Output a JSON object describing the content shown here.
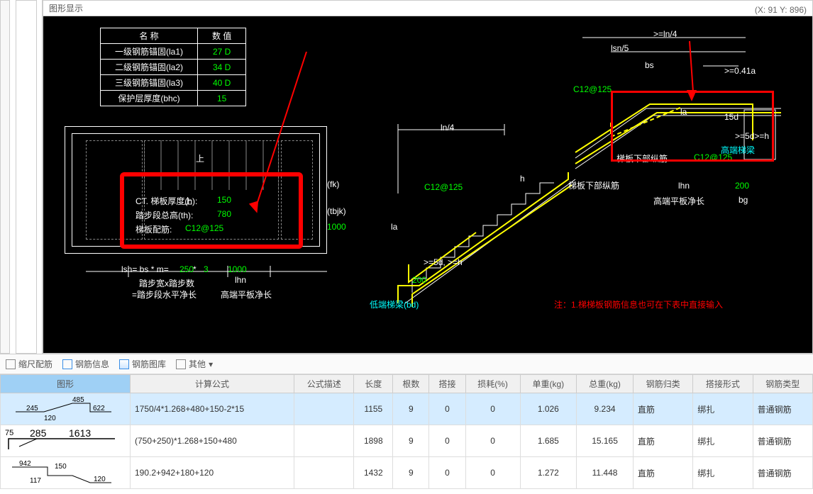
{
  "panel_title": "图形显示",
  "coord_text": "(X: 91 Y: 896)",
  "param_table": {
    "header_name": "名  称",
    "header_value": "数  值",
    "rows": [
      {
        "name": "一级钢筋锚固(la1)",
        "value": "27 D"
      },
      {
        "name": "二级钢筋锚固(la2)",
        "value": "34 D"
      },
      {
        "name": "三级钢筋锚固(la3)",
        "value": "40 D"
      },
      {
        "name": "保护层厚度(bhc)",
        "value": "15"
      }
    ]
  },
  "left_box": {
    "l1": "CT. 梯板厚度(h):",
    "v1": "150",
    "l2": "踏步段总高(th):",
    "v2": "780",
    "l3": "梯板配筋:",
    "v3": "C12@125",
    "lsn_label": "lsn= bs * m=",
    "lsn_v1": "250",
    "lsn_star": " * ",
    "lsn_v2": "3",
    "lsn_rhs": "1000",
    "lhn_lbl": "lhn",
    "foot1": "踏步宽x踏步数",
    "foot2": "=踏步段水平净长",
    "foot3": "高端平板净长",
    "fk": "(fk)",
    "tbjk": "(tbjk)",
    "v1000": "1000",
    "up": "上"
  },
  "middle": {
    "ln4": "ln/4",
    "c12": "C12@125",
    "la": "la",
    "gte": ">=5d, >=h",
    "v200": "200",
    "bottom_label": "低端梯梁(bd)",
    "h": "h",
    "bottom_long": "梯板下部纵筋"
  },
  "right": {
    "top1": ">=ln/4",
    "top2": "lsn/5",
    "bs": "bs",
    "c12": "C12@125",
    "la": "la",
    "ge041": ">=0.41a",
    "fifteen_d": "15d",
    "ge5d": ">=5d>=h",
    "label_high": "高端梯梁",
    "bottom_long": "梯板下部纵筋",
    "c12b": "C12@125",
    "lhn": "lhn",
    "foot": "高端平板净长",
    "v200": "200",
    "bg": "bg",
    "note": "注：1.梯梯板钢筋信息也可在下表中直接输入"
  },
  "toolbar": {
    "ruler": "缩尺配筋",
    "info": "钢筋信息",
    "lib": "钢筋图库",
    "other": "其他"
  },
  "grid": {
    "headers": [
      "图形",
      "计算公式",
      "公式描述",
      "长度",
      "根数",
      "搭接",
      "损耗(%)",
      "单重(kg)",
      "总重(kg)",
      "钢筋归类",
      "搭接形式",
      "钢筋类型"
    ],
    "rows": [
      {
        "shape_labels": [
          "245",
          "485",
          "622",
          "120"
        ],
        "formula": "1750/4*1.268+480+150-2*15",
        "desc": "",
        "len": "1155",
        "num": "9",
        "lap": "0",
        "loss": "0",
        "uw": "1.026",
        "tw": "9.234",
        "cat": "直筋",
        "lapform": "绑扎",
        "type": "普通钢筋"
      },
      {
        "shape_labels": [
          "75",
          "285",
          "1613"
        ],
        "formula": "(750+250)*1.268+150+480",
        "desc": "",
        "len": "1898",
        "num": "9",
        "lap": "0",
        "loss": "0",
        "uw": "1.685",
        "tw": "15.165",
        "cat": "直筋",
        "lapform": "绑扎",
        "type": "普通钢筋"
      },
      {
        "shape_labels": [
          "942",
          "150",
          "117",
          "120"
        ],
        "formula": "190.2+942+180+120",
        "desc": "",
        "len": "1432",
        "num": "9",
        "lap": "0",
        "loss": "0",
        "uw": "1.272",
        "tw": "11.448",
        "cat": "直筋",
        "lapform": "绑扎",
        "type": "普通钢筋"
      }
    ]
  }
}
